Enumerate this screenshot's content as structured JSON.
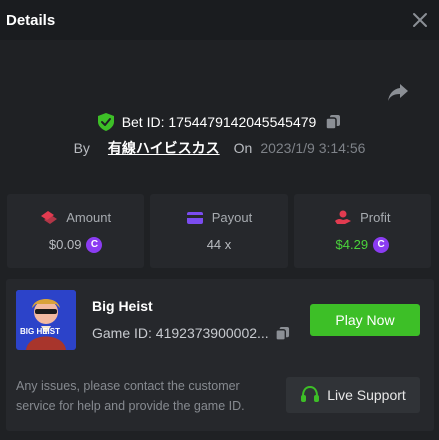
{
  "header": {
    "title": "Details"
  },
  "bet": {
    "id_label": "Bet ID: 1754479142045545479",
    "by_label": "By",
    "user": "有線ハイビスカス",
    "on_label": "On",
    "date": "2023/1/9 3:14:56"
  },
  "stats": {
    "amount": {
      "label": "Amount",
      "value": "$0.09",
      "coin": "C"
    },
    "payout": {
      "label": "Payout",
      "value": "44 x"
    },
    "profit": {
      "label": "Profit",
      "value": "$4.29",
      "coin": "C"
    }
  },
  "game": {
    "name": "Big Heist",
    "id_label": "Game ID: 4192373900002...",
    "thumb_text": "BIG HEIST",
    "play_label": "Play Now"
  },
  "support": {
    "notice": "Any issues, please contact the customer service for help and provide the game ID.",
    "button_label": "Live Support"
  },
  "colors": {
    "accent_green": "#3dbf27",
    "profit_green": "#4ad33b",
    "coin_purple": "#8b3cf2",
    "amount_red": "#e23b50",
    "payout_purple": "#7b4cf0"
  },
  "icons": [
    "close-icon",
    "share-icon",
    "shield-check-icon",
    "copy-icon",
    "amount-icon",
    "payout-icon",
    "profit-icon",
    "coin-icon",
    "headset-icon"
  ]
}
